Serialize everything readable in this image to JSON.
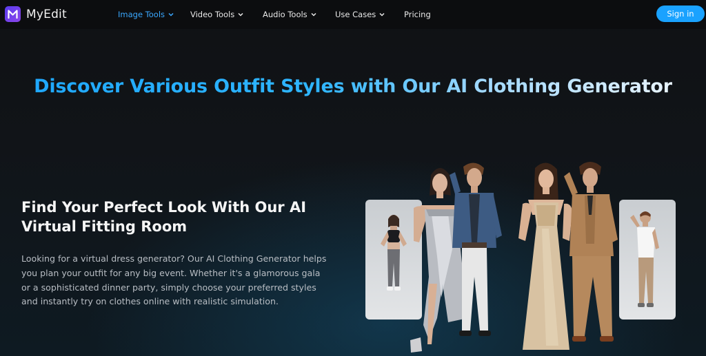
{
  "brand": {
    "name": "MyEdit",
    "logo_icon": "myedit-logo-icon",
    "logo_color": "#6a40ee"
  },
  "nav": {
    "items": [
      {
        "label": "Image Tools",
        "has_dropdown": true,
        "active": true
      },
      {
        "label": "Video Tools",
        "has_dropdown": true,
        "active": false
      },
      {
        "label": "Audio Tools",
        "has_dropdown": true,
        "active": false
      },
      {
        "label": "Use Cases",
        "has_dropdown": true,
        "active": false
      },
      {
        "label": "Pricing",
        "has_dropdown": false,
        "active": false
      }
    ],
    "signin_label": "Sign in",
    "accent": "#1aa2ff"
  },
  "hero": {
    "title": "Discover Various Outfit Styles with Our AI Clothing Generator"
  },
  "section": {
    "heading": "Find Your Perfect Look With Our AI Virtual Fitting Room",
    "body": "Looking for a virtual dress generator? Our AI Clothing Generator helps you plan your outfit for any big event. Whether it's a glamorous gala or a sophisticated dinner party, simply choose your preferred styles and instantly try on clothes online with realistic simulation."
  }
}
